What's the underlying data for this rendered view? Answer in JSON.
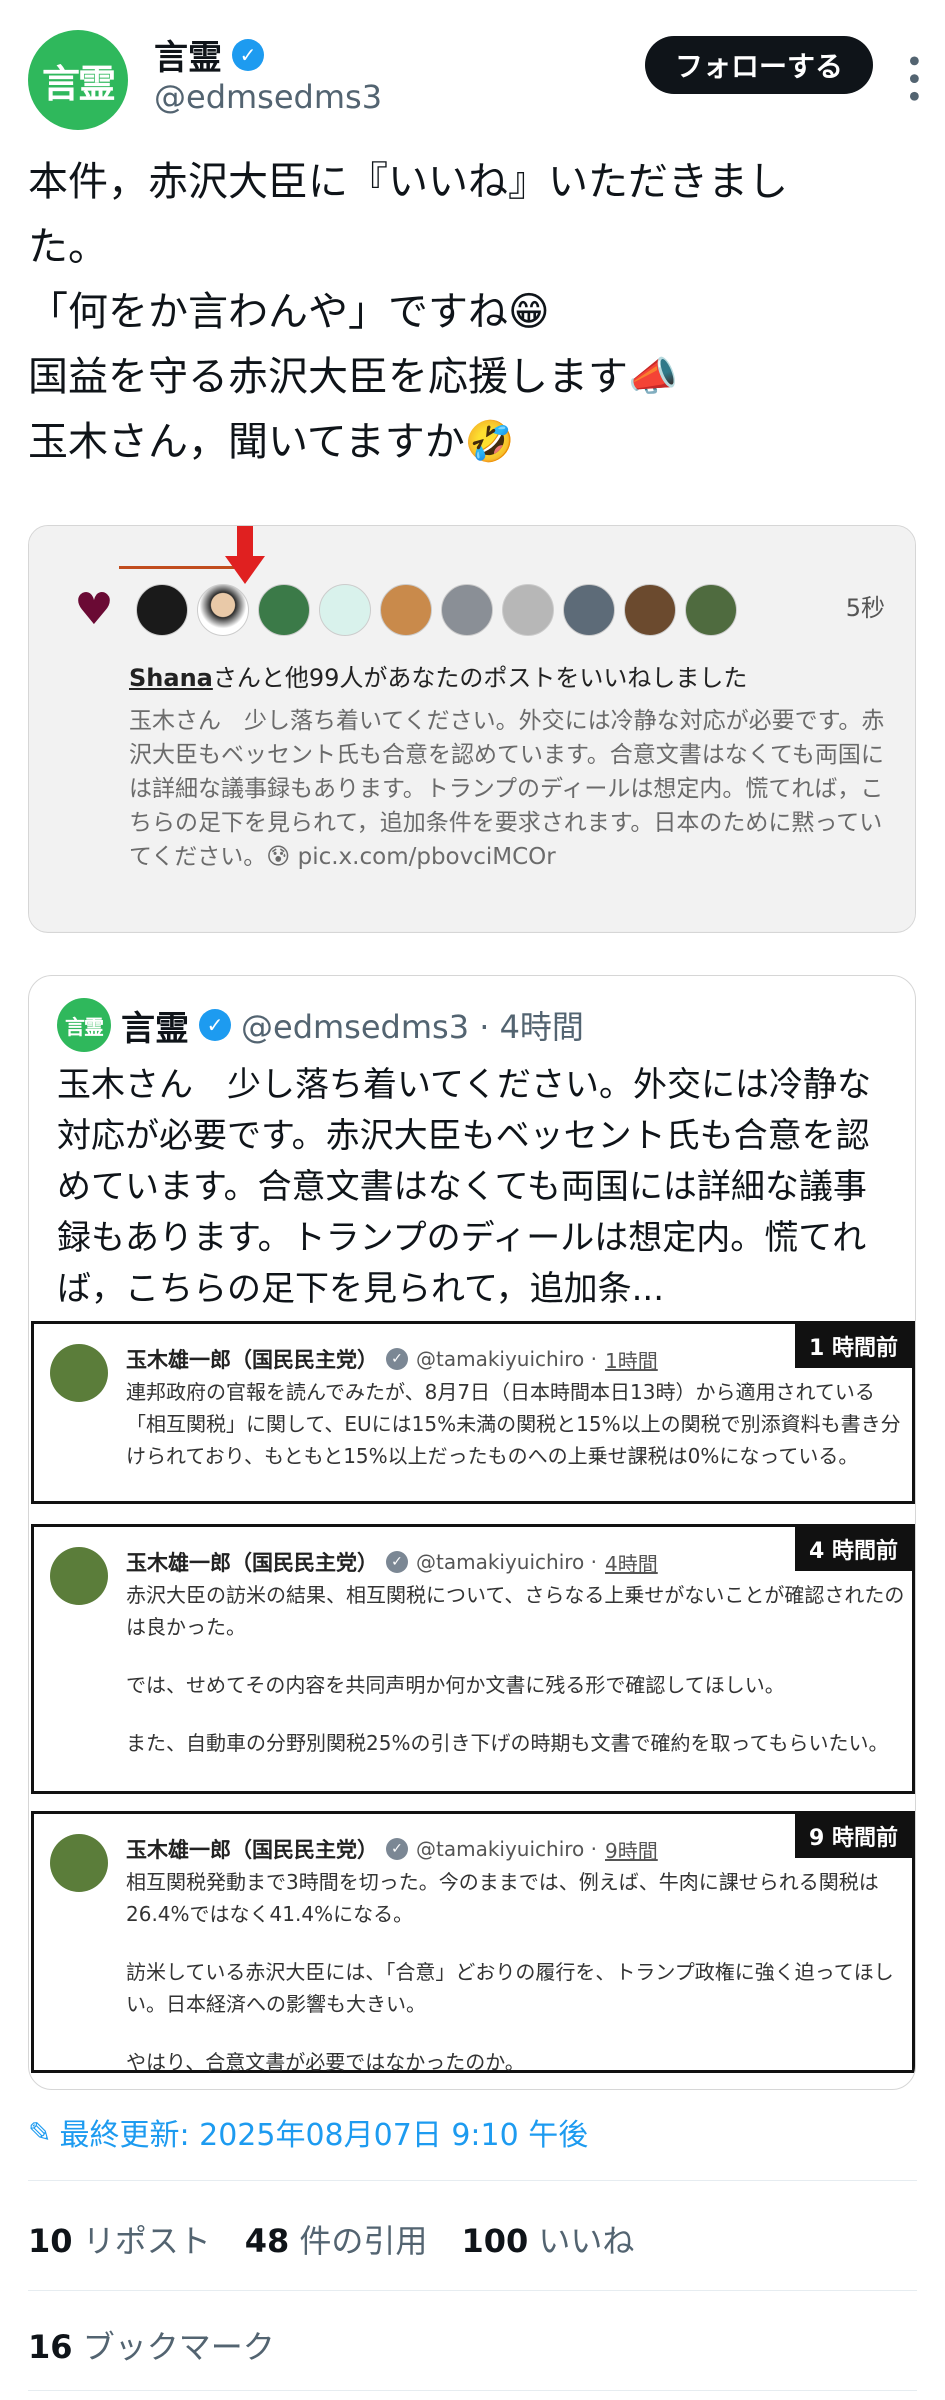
{
  "author": {
    "avatar_text": "言霊",
    "name": "言霊",
    "handle": "@edmsedms3",
    "follow_label": "フォローする"
  },
  "post": {
    "lines": [
      "本件，赤沢大臣に『いいね』いただきまし",
      "た。",
      "「何をか言わんや」ですね😁",
      "国益を守る赤沢大臣を応援します📣",
      "玉木さん，聞いてますか🤣"
    ]
  },
  "notification": {
    "time": "5秒",
    "title_user": "Shana",
    "title_rest": "さんと他99人があなたのポストをいいねしました",
    "body": "玉木さん　少し落ち着いてください。外交には冷静な対応が必要です。赤沢大臣もベッセント氏も合意を認めています。合意文書はなくても両国には詳細な議事録もあります。トランプのディールは想定内。慌てれば，こちらの足下を見られて，追加条件を要求されます。日本のために黙っていてください。😰",
    "link": "pic.x.com/pbovciMCOr"
  },
  "quote": {
    "avatar_text": "言霊",
    "name": "言霊",
    "handle_time": "@edmsedms3 · 4時間",
    "text": "玉木さん　少し落ち着いてください。外交には冷静な対応が必要です。赤沢大臣もベッセント氏も合意を認めています。合意文書はなくても両国には詳細な議事録もあります。トランプのディールは想定内。慌てれば，こちらの足下を見られて，追加条..."
  },
  "screenshots": [
    {
      "tag": "1 時間前",
      "name": "玉木雄一郎（国民民主党）",
      "handle": "@tamakiyuichiro ·",
      "ago": "1時間",
      "paragraphs": [
        "連邦政府の官報を読んでみたが、8月7日（日本時間本日13時）から適用されている「相互関税」に関して、EUには15%未満の関税と15%以上の関税で別添資料も書き分けられており、もともと15%以上だったものへの上乗せ課税は0%になっている。"
      ]
    },
    {
      "tag": "4 時間前",
      "name": "玉木雄一郎（国民民主党）",
      "handle": "@tamakiyuichiro ·",
      "ago": "4時間",
      "paragraphs": [
        "赤沢大臣の訪米の結果、相互関税について、さらなる上乗せがないことが確認されたのは良かった。",
        "では、せめてその内容を共同声明か何か文書に残る形で確認してほしい。",
        "また、自動車の分野別関税25%の引き下げの時期も文書で確約を取ってもらいたい。"
      ]
    },
    {
      "tag": "9 時間前",
      "name": "玉木雄一郎（国民民主党）",
      "handle": "@tamakiyuichiro ·",
      "ago": "9時間",
      "paragraphs": [
        "相互関税発動まで3時間を切った。今のままでは、例えば、牛肉に課せられる関税は26.4%ではなく41.4%になる。",
        "訪米している赤沢大臣には、「合意」どおりの履行を、トランプ政権に強く迫ってほしい。日本経済への影響も大きい。",
        "やはり、合意文書が必要ではなかったのか。"
      ]
    }
  ],
  "footer": {
    "updated": "最終更新: 2025年08月07日 9:10 午後",
    "reposts_count": "10",
    "reposts_label": "リポスト",
    "quotes_count": "48",
    "quotes_label": "件の引用",
    "likes_count": "100",
    "likes_label": "いいね",
    "bookmarks_count": "16",
    "bookmarks_label": "ブックマーク"
  },
  "colors": {
    "accent": "#1d9bf0",
    "avatar_green": "#2fb85c",
    "follow_bg": "#0f1419"
  }
}
